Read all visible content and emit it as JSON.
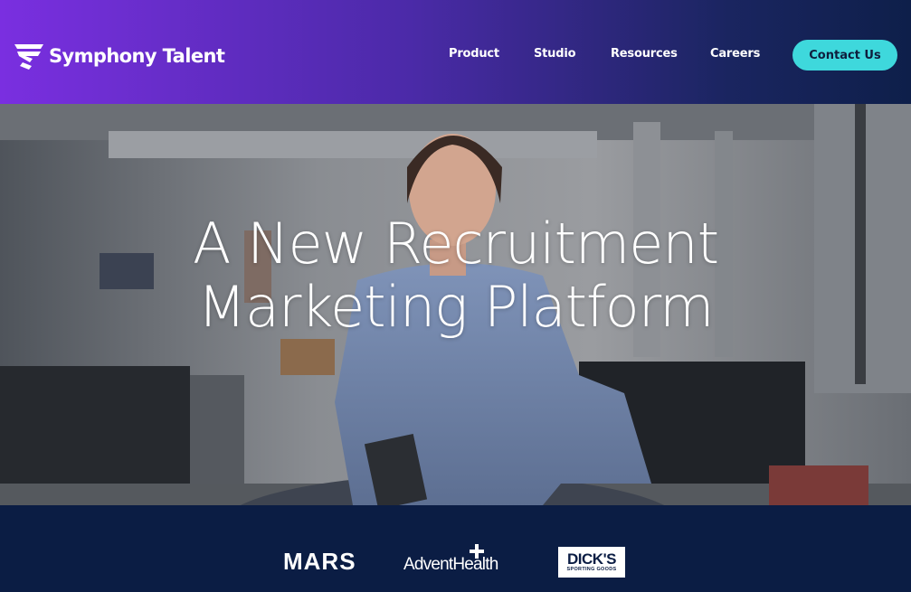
{
  "brand": {
    "name": "Symphony Talent",
    "logo_icon": "symphony-talent-logo-mark"
  },
  "nav": {
    "items": [
      {
        "label": "Product"
      },
      {
        "label": "Studio"
      },
      {
        "label": "Resources"
      },
      {
        "label": "Careers"
      }
    ],
    "contact_label": "Contact Us"
  },
  "hero": {
    "title_line1": "A New Recruitment",
    "title_line2": "Marketing Platform",
    "image": "woman-in-office-photo"
  },
  "client_logos": {
    "mars": "MARS",
    "advent": "AdventHealth",
    "dicks_main": "DICK'S",
    "dicks_sub": "SPORTING GOODS"
  },
  "colors": {
    "header_gradient_start": "#7a2fe0",
    "header_gradient_end": "#0e1f4a",
    "accent_button": "#3ed8dc",
    "logo_bar": "#0b1d44"
  }
}
